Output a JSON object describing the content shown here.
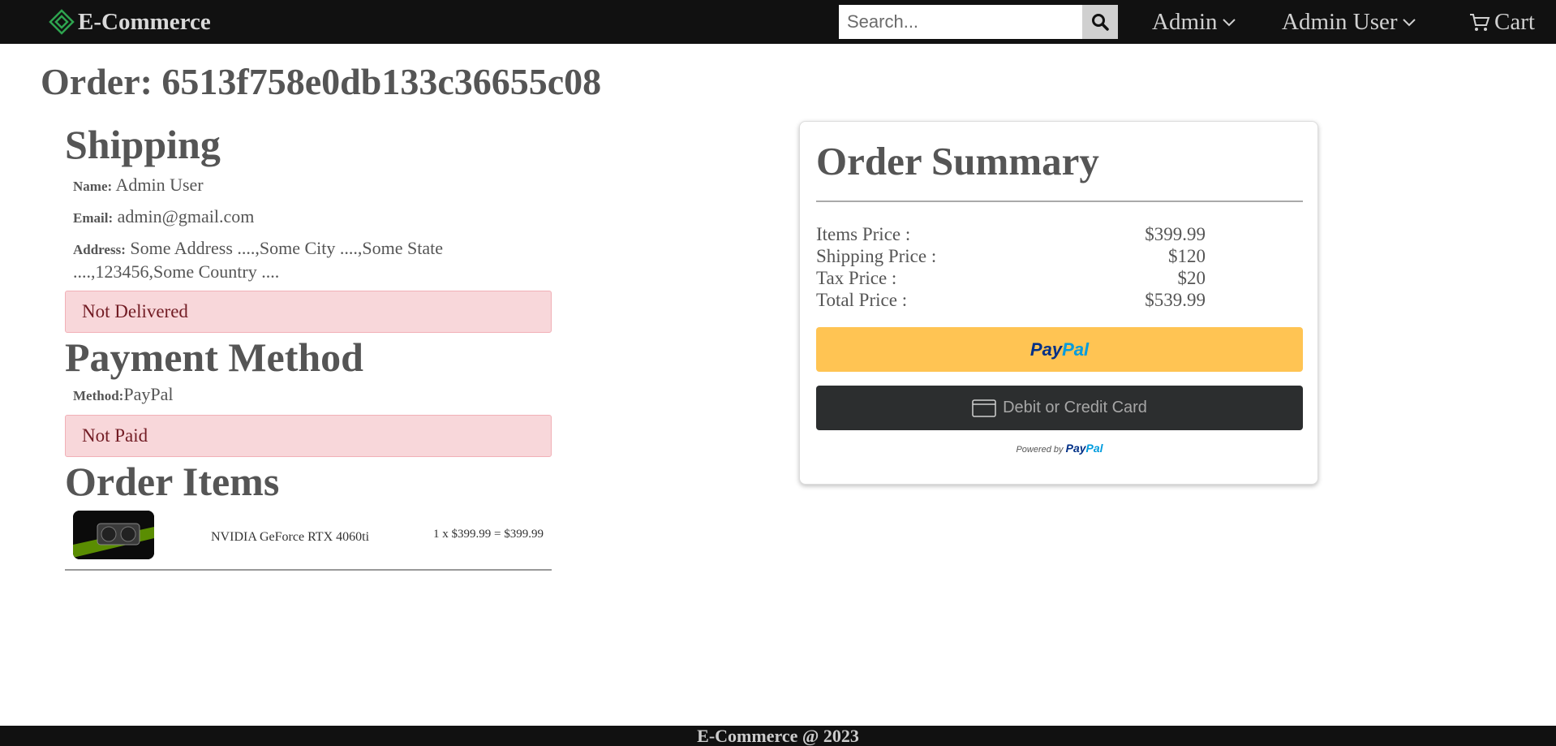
{
  "navbar": {
    "brand": "E-Commerce",
    "search_placeholder": "Search...",
    "admin_menu": "Admin",
    "user_menu": "Admin User",
    "cart": "Cart"
  },
  "order": {
    "title": "Order: 6513f758e0db133c36655c08"
  },
  "shipping": {
    "heading": "Shipping",
    "name_label": "Name:",
    "name": "Admin User",
    "email_label": "Email:",
    "email": "admin@gmail.com",
    "address_label": "Address:",
    "address": "Some Address ....,Some City ....,Some State ....,123456,Some Country ....",
    "delivery_status": "Not Delivered"
  },
  "payment": {
    "heading": "Payment Method",
    "method_label": "Method:",
    "method": "PayPal",
    "paid_status": "Not Paid"
  },
  "order_items": {
    "heading": "Order Items",
    "items": [
      {
        "name": "NVIDIA GeForce RTX 4060ti",
        "calc": "1 x $399.99 = $399.99"
      }
    ]
  },
  "summary": {
    "heading": "Order Summary",
    "rows": [
      {
        "label": "Items Price :",
        "value": "$399.99"
      },
      {
        "label": "Shipping Price :",
        "value": "$120"
      },
      {
        "label": "Tax Price :",
        "value": "$20"
      },
      {
        "label": "Total Price :",
        "value": "$539.99"
      }
    ],
    "paypal_part1": "Pay",
    "paypal_part2": "Pal",
    "card_button": "Debit or Credit Card",
    "powered_by": "Powered by",
    "powered_logo1": "Pay",
    "powered_logo2": "Pal"
  },
  "footer": {
    "text": "E-Commerce @ 2023"
  },
  "colors": {
    "navbar_bg": "#111111",
    "brand_icon": "#2ea44f",
    "alert_bg": "#f8d7da",
    "paypal_yellow": "#ffc453",
    "card_button_bg": "#2c2e2f"
  }
}
